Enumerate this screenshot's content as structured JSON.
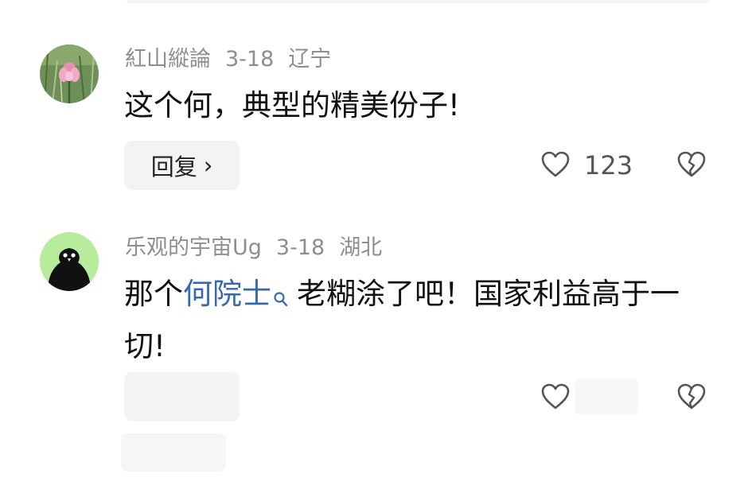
{
  "comments": [
    {
      "username": "紅山縱論",
      "date": "3-18",
      "location": "辽宁",
      "text": "这个何，典型的精美份子!",
      "reply_label": "回复",
      "reply_chevron": "›",
      "like_count": "123",
      "avatar": "lotus-flower-avatar",
      "like_icon": "heart-outline-icon",
      "dislike_icon": "broken-heart-icon"
    },
    {
      "username": "乐观的宇宙Ug",
      "date": "3-18",
      "location": "湖北",
      "text_before_link": "那个",
      "link_text": "何院士",
      "text_after_link": "老糊涂了吧！国家利益高于一切!",
      "link_icon": "search-icon",
      "avatar": "black-bird-avatar",
      "like_icon": "heart-outline-icon",
      "dislike_icon": "broken-heart-icon"
    }
  ],
  "colors": {
    "meta_text": "#8e8e8e",
    "body_text": "#111111",
    "link": "#3a68b0",
    "button_bg": "#f3f3f3",
    "avatar2_bg": "#b6ec9c"
  }
}
